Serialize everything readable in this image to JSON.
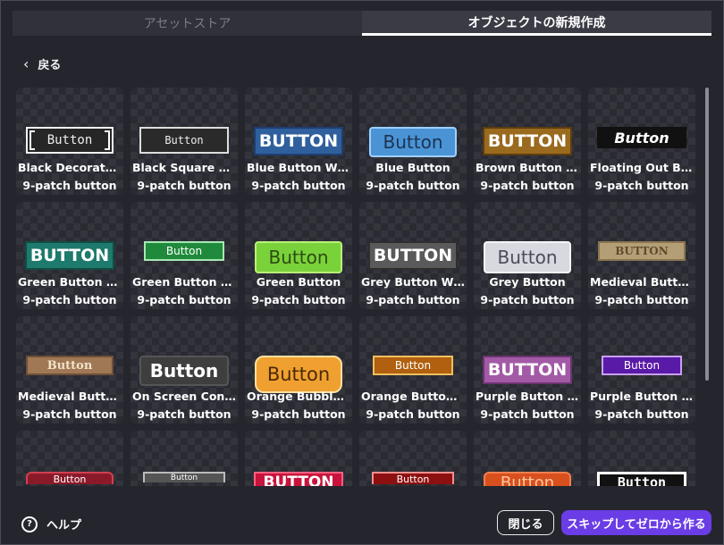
{
  "tabs": [
    {
      "label": "アセットストア",
      "active": false
    },
    {
      "label": "オブジェクトの新規作成",
      "active": true
    }
  ],
  "back_label": "戻る",
  "grid": {
    "rows": [
      [
        {
          "name": "Black Decorated Button",
          "sub": "9-patch button",
          "preview": "Button",
          "style": "pv-blackdec"
        },
        {
          "name": "Black Square Decorated Button",
          "sub": "9-patch button",
          "preview": "Button",
          "style": "pv-blacksq"
        },
        {
          "name": "Blue Button With Shadow",
          "sub": "9-patch button",
          "preview": "BUTTON",
          "style": "pv-blue"
        },
        {
          "name": "Blue Button",
          "sub": "9-patch button",
          "preview": "Button",
          "style": "pv-blueplain"
        },
        {
          "name": "Brown Button With Shadow",
          "sub": "9-patch button",
          "preview": "BUTTON",
          "style": "pv-brown"
        },
        {
          "name": "Floating Out Button",
          "sub": "9-patch button",
          "preview": "Button",
          "style": "pv-floatout"
        }
      ],
      [
        {
          "name": "Green Button With Shadow",
          "sub": "9-patch button",
          "preview": "BUTTON",
          "style": "pv-green"
        },
        {
          "name": "Green Button With Wings",
          "sub": "9-patch button",
          "preview": "Button",
          "style": "pv-greenwing"
        },
        {
          "name": "Green Button",
          "sub": "9-patch button",
          "preview": "Button",
          "style": "pv-greenplain"
        },
        {
          "name": "Grey Button With Shadow",
          "sub": "9-patch button",
          "preview": "BUTTON",
          "style": "pv-grey"
        },
        {
          "name": "Grey Button",
          "sub": "9-patch button",
          "preview": "Button",
          "style": "pv-greyplain"
        },
        {
          "name": "Medieval Button Stone",
          "sub": "9-patch button",
          "preview": "BUTTON",
          "style": "pv-medieval1"
        }
      ],
      [
        {
          "name": "Medieval Button Wood",
          "sub": "9-patch button",
          "preview": "Button",
          "style": "pv-medieval2"
        },
        {
          "name": "On Screen Control Button",
          "sub": "9-patch button",
          "preview": "Button",
          "style": "pv-onscreen"
        },
        {
          "name": "Orange Bubble Button",
          "sub": "9-patch button",
          "preview": "Button",
          "style": "pv-orangebub"
        },
        {
          "name": "Orange Button With Wings",
          "sub": "9-patch button",
          "preview": "Button",
          "style": "pv-orangewing"
        },
        {
          "name": "Purple Button With Shadow",
          "sub": "9-patch button",
          "preview": "BUTTON",
          "style": "pv-purple"
        },
        {
          "name": "Purple Button With Wings",
          "sub": "9-patch button",
          "preview": "Button",
          "style": "pv-purplewing"
        }
      ],
      [
        {
          "name": "",
          "sub": "",
          "preview": "Button",
          "style": "pv-r-darkred"
        },
        {
          "name": "",
          "sub": "",
          "preview": "Button",
          "style": "pv-r-silver"
        },
        {
          "name": "",
          "sub": "",
          "preview": "BUTTON",
          "style": "pv-r-crimson"
        },
        {
          "name": "",
          "sub": "",
          "preview": "Button",
          "style": "pv-r-redwing"
        },
        {
          "name": "",
          "sub": "",
          "preview": "Button",
          "style": "pv-r-orange"
        },
        {
          "name": "",
          "sub": "",
          "preview": "Button",
          "style": "pv-r-white"
        }
      ]
    ]
  },
  "footer": {
    "help_label": "ヘルプ",
    "close_label": "閉じる",
    "skip_label": "スキップしてゼロから作る"
  },
  "colors": {
    "background": "#25262d",
    "accent": "#6a3de6"
  }
}
